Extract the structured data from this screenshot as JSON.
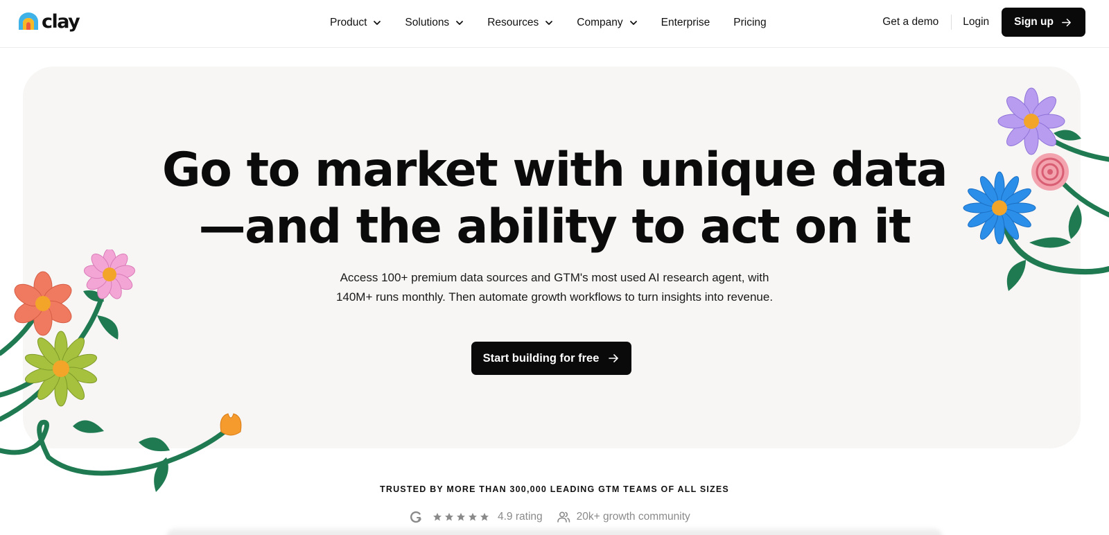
{
  "brand": {
    "name": "clay"
  },
  "nav": {
    "items": [
      {
        "label": "Product",
        "dropdown": true
      },
      {
        "label": "Solutions",
        "dropdown": true
      },
      {
        "label": "Resources",
        "dropdown": true
      },
      {
        "label": "Company",
        "dropdown": true
      },
      {
        "label": "Enterprise",
        "dropdown": false
      },
      {
        "label": "Pricing",
        "dropdown": false
      }
    ],
    "get_demo": "Get a demo",
    "login": "Login",
    "signup": "Sign up"
  },
  "hero": {
    "headline_line1": "Go to market with unique data",
    "headline_line2": "—and the ability to act on it",
    "subheadline": "Access 100+ premium data sources and GTM's most used AI research agent, with 140M+ runs monthly. Then automate growth workflows to turn insights into revenue.",
    "cta": "Start building for free"
  },
  "trust": {
    "heading": "TRUSTED BY MORE THAN 300,000 LEADING GTM TEAMS OF ALL SIZES",
    "rating_stars": 5,
    "rating": "4.9 rating",
    "community": "20k+ growth community"
  },
  "icons": {
    "chevron": "chevron-down-icon",
    "arrow": "arrow-right-icon",
    "g2": "g2-logo-icon",
    "star": "star-icon",
    "people": "people-icon"
  },
  "colors": {
    "primary_button": "#0a0a0a",
    "hero_background": "#f7f6f4",
    "muted_text": "#8a8a8a",
    "stem_green": "#1f7a52"
  }
}
